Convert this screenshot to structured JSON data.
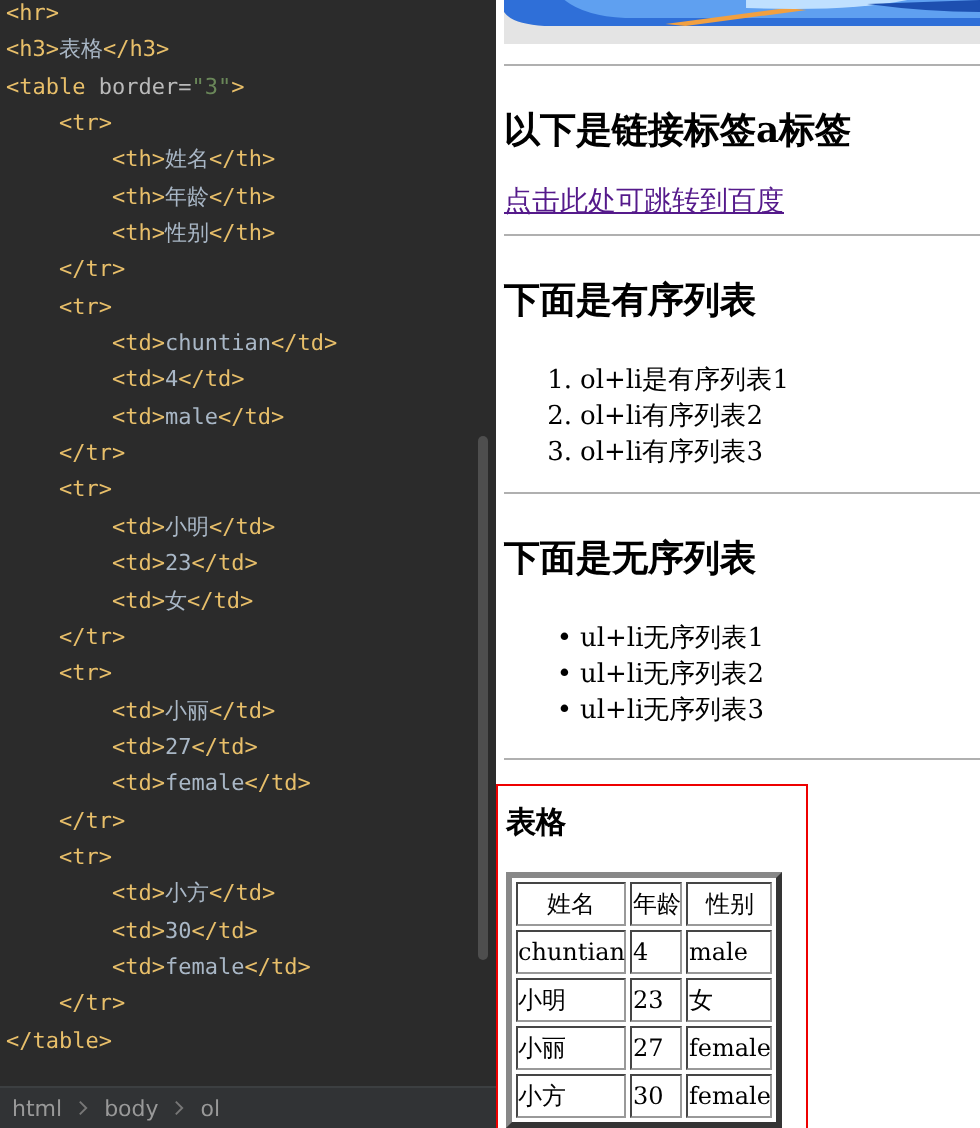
{
  "editor": {
    "lines": [
      "<hr>",
      "<h3>表格</h3>",
      "<table border=\"3\">",
      "    <tr>",
      "        <th>姓名</th>",
      "        <th>年龄</th>",
      "        <th>性别</th>",
      "    </tr>",
      "    <tr>",
      "        <td>chuntian</td>",
      "        <td>4</td>",
      "        <td>male</td>",
      "    </tr>",
      "    <tr>",
      "        <td>小明</td>",
      "        <td>23</td>",
      "        <td>女</td>",
      "    </tr>",
      "    <tr>",
      "        <td>小丽</td>",
      "        <td>27</td>",
      "        <td>female</td>",
      "    </tr>",
      "    <tr>",
      "        <td>小方</td>",
      "        <td>30</td>",
      "        <td>female</td>",
      "    </tr>",
      "</table>"
    ],
    "breadcrumb": [
      "html",
      "body",
      "ol"
    ]
  },
  "preview": {
    "link_heading": "以下是链接标签a标签",
    "link": "点击此处可跳转到百度",
    "ol_heading": "下面是有序列表",
    "ol_items": [
      {
        "marker": "1.",
        "text": "ol+li是有序列表1"
      },
      {
        "marker": "2.",
        "text": "ol+li有序列表2"
      },
      {
        "marker": "3.",
        "text": "ol+li有序列表3"
      }
    ],
    "ul_heading": "下面是无序列表",
    "ul_items": [
      {
        "marker": "•",
        "text": "ul+li无序列表1"
      },
      {
        "marker": "•",
        "text": "ul+li无序列表2"
      },
      {
        "marker": "•",
        "text": "ul+li无序列表3"
      }
    ],
    "table_section": {
      "heading": "表格",
      "columns": [
        "姓名",
        "年龄",
        "性别"
      ],
      "rows": [
        [
          "chuntian",
          "4",
          "male"
        ],
        [
          "小明",
          "23",
          "女"
        ],
        [
          "小丽",
          "27",
          "female"
        ],
        [
          "小方",
          "30",
          "female"
        ]
      ]
    }
  }
}
